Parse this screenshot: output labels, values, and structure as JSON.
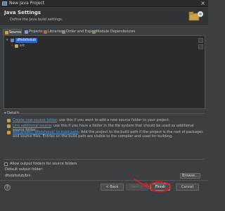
{
  "window": {
    "title": "New Java Project",
    "close_glyph": "×"
  },
  "header": {
    "title": "Java Settings",
    "subtitle": "Define the Java build settings."
  },
  "tabs": [
    {
      "label": "Source",
      "active": true
    },
    {
      "label": "Projects",
      "active": false
    },
    {
      "label": "Libraries",
      "active": false
    },
    {
      "label": "Order and Export",
      "active": false
    },
    {
      "label": "Module Dependencies",
      "active": false
    }
  ],
  "tree": {
    "items": [
      {
        "label": "dfsdsfsdub",
        "selected": true,
        "icon": "java-project-icon"
      },
      {
        "label": "src",
        "selected": false,
        "icon": "source-folder-icon"
      }
    ]
  },
  "details": {
    "label": "Details",
    "rows": [
      {
        "link": "Create new source folder",
        "text": ": use this if you want to add a new source folder to your project."
      },
      {
        "link": "Link additional source",
        "text": ": use this if you have a folder in the file system that should be used as additional source folder."
      },
      {
        "link": "Add project 'dfsdsfsdub' to build path",
        "text": ": Add the project to the build path if the project is the root of packages and source files. Entries on the build path are visible to the compiler and used for building."
      }
    ]
  },
  "output": {
    "allow_label": "Allow output folders for source folders",
    "default_label": "Default output folder:",
    "default_value": "dfsdsfsdub/bin",
    "browse_label": "Browse..."
  },
  "footer": {
    "help_glyph": "?",
    "back_label": "< Back",
    "next_label": "Next >",
    "finish_label": "Finish",
    "cancel_label": "Cancel"
  },
  "colors": {
    "link": "#5b9bd5",
    "selection": "#2f65ca",
    "annotation": "#e02020"
  }
}
